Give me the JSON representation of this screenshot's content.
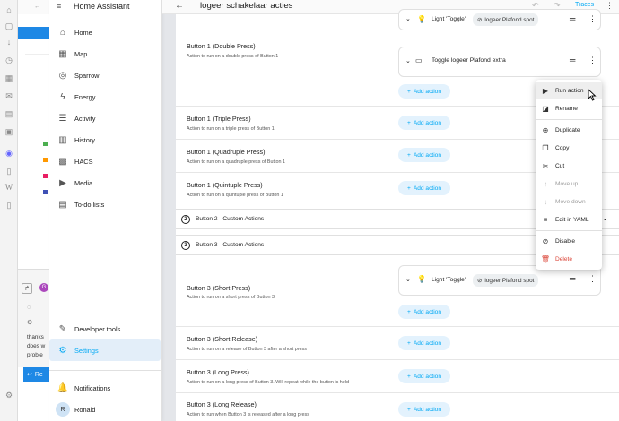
{
  "sidebar": {
    "title": "Home Assistant",
    "items": [
      {
        "label": "Home",
        "icon": "home-icon"
      },
      {
        "label": "Map",
        "icon": "map-icon"
      },
      {
        "label": "Sparrow",
        "icon": "sparrow-icon"
      },
      {
        "label": "Energy",
        "icon": "energy-icon"
      },
      {
        "label": "Activity",
        "icon": "activity-icon"
      },
      {
        "label": "History",
        "icon": "history-icon"
      },
      {
        "label": "HACS",
        "icon": "hacs-icon"
      },
      {
        "label": "Media",
        "icon": "media-icon"
      },
      {
        "label": "To-do lists",
        "icon": "todo-icon"
      }
    ],
    "bottom": {
      "developer_tools": "Developer tools",
      "settings": "Settings",
      "notifications": "Notifications",
      "user_name": "Ronald",
      "user_initial": "R"
    }
  },
  "header": {
    "title": "logeer schakelaar acties",
    "traces": "Traces"
  },
  "add_action_label": "Add action",
  "sections": {
    "top_card": {
      "name": "Light 'Toggle'",
      "target": "logeer Plafond spot"
    },
    "b1_double": {
      "title": "Button 1 (Double Press)",
      "sub": "Action to run on a double press of Button 1"
    },
    "b1_double_card": "Toggle logeer Plafond extra",
    "b1_triple": {
      "title": "Button 1 (Triple Press)",
      "sub": "Action to run on a triple press of Button 1"
    },
    "b1_quad": {
      "title": "Button 1 (Quadruple Press)",
      "sub": "Action to run on a quadruple press of Button 1"
    },
    "b1_quint": {
      "title": "Button 1 (Quintuple Press)",
      "sub": "Action to run on a quintuple press of Button 1"
    },
    "group2": {
      "num": "2",
      "label": "Button 2 - Custom Actions"
    },
    "group3": {
      "num": "3",
      "label": "Button 3 - Custom Actions"
    },
    "b3_short": {
      "title": "Button 3 (Short Press)",
      "sub": "Action to run on a short press of Button 3"
    },
    "b3_short_card": {
      "name": "Light 'Toggle'",
      "target": "logeer Plafond spot"
    },
    "b3_short_rel": {
      "title": "Button 3 (Short Release)",
      "sub": "Action to run on a release of Button 3 after a short press"
    },
    "b3_long": {
      "title": "Button 3 (Long Press)",
      "sub": "Action to run on a long press of Button 3. Will repeat while the button is held"
    },
    "b3_long_rel": {
      "title": "Button 3 (Long Release)",
      "sub": "Action to run when Button 3 is released after a long press"
    }
  },
  "menu": {
    "run": "Run action",
    "rename": "Rename",
    "duplicate": "Duplicate",
    "copy": "Copy",
    "cut": "Cut",
    "move_up": "Move up",
    "move_down": "Move down",
    "edit_yaml": "Edit in YAML",
    "disable": "Disable",
    "delete": "Delete"
  },
  "background": {
    "chat_text": "thanks does w proble",
    "reply_label": "Re"
  },
  "colors": {
    "accent": "#03a9f4",
    "danger": "#db4437",
    "chip": "#eceff1"
  }
}
